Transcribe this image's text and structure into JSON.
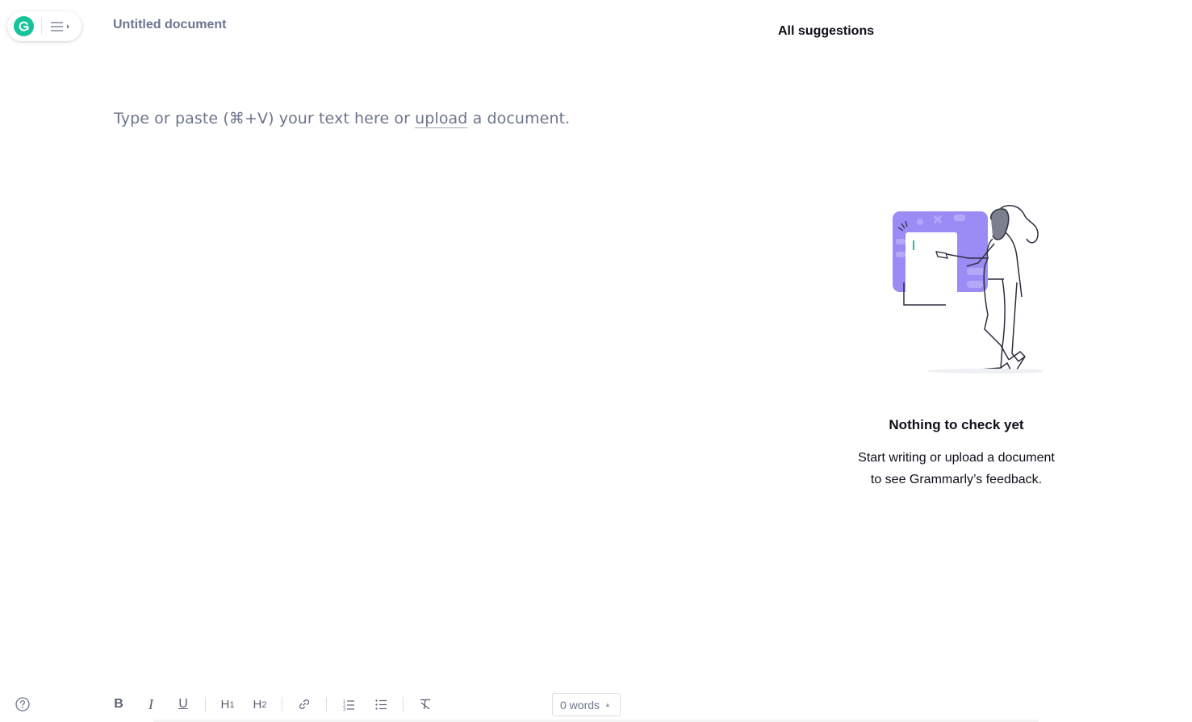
{
  "header": {
    "document_title": "Untitled document"
  },
  "editor": {
    "placeholder_before": "Type or paste (⌘+V) your text here or ",
    "placeholder_link": "upload",
    "placeholder_after": " a document."
  },
  "suggestions_panel": {
    "title": "All suggestions",
    "empty_title": "Nothing to check yet",
    "empty_line1": "Start writing or upload a document",
    "empty_line2": "to see Grammarly’s feedback."
  },
  "toolbar": {
    "bold": "B",
    "italic": "I",
    "underline": "U",
    "h1_letter": "H",
    "h1_digit": "1",
    "h2_letter": "H",
    "h2_digit": "2"
  },
  "status": {
    "word_count": "0 words"
  },
  "colors": {
    "brand": "#15c39a",
    "illustration_accent": "#9b8cf5",
    "muted_text": "#6d758d"
  },
  "icons": {
    "logo": "grammarly-logo-icon",
    "menu": "hamburger-menu-icon",
    "help": "help-circle-icon",
    "link": "link-icon",
    "ordered_list": "ordered-list-icon",
    "bullet_list": "bullet-list-icon",
    "clear_format": "clear-formatting-icon"
  }
}
